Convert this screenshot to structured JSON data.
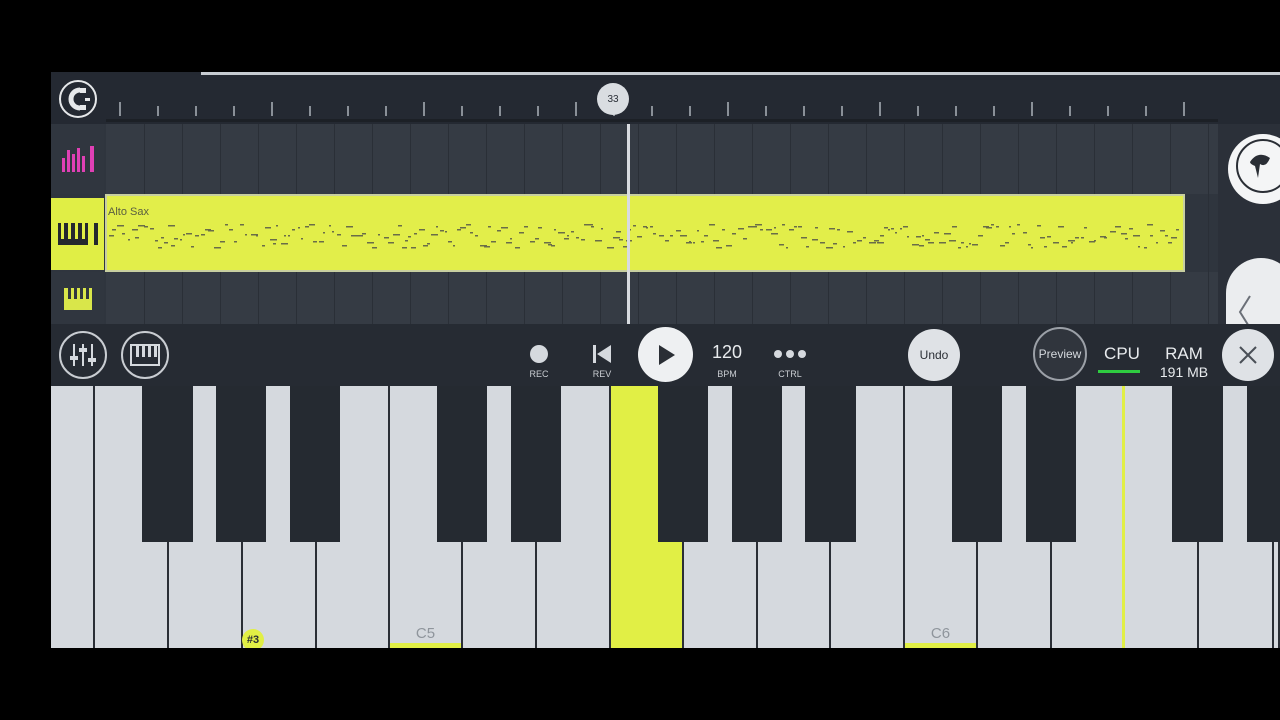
{
  "timeline": {
    "playhead_bar": "33"
  },
  "tracks": [
    {
      "name": "",
      "icon": "equalizer-icon"
    },
    {
      "name": "Alto Sax",
      "icon": "piano-roll-icon"
    },
    {
      "name": "",
      "icon": "keyboard-icon"
    }
  ],
  "controls": {
    "rec_label": "REC",
    "rev_label": "REV",
    "bpm_value": "120",
    "bpm_label": "BPM",
    "ctrl_label": "CTRL",
    "undo_label": "Undo",
    "preview_label": "Preview",
    "cpu_label": "CPU",
    "ram_label": "RAM",
    "ram_value": "191 MB"
  },
  "keyboard": {
    "sharp_badge": "#3",
    "octave_labels": [
      "C5",
      "C6"
    ]
  },
  "colors": {
    "accent": "#e1ef45",
    "background": "#262b33",
    "cpu_meter": "#2ecc40"
  }
}
